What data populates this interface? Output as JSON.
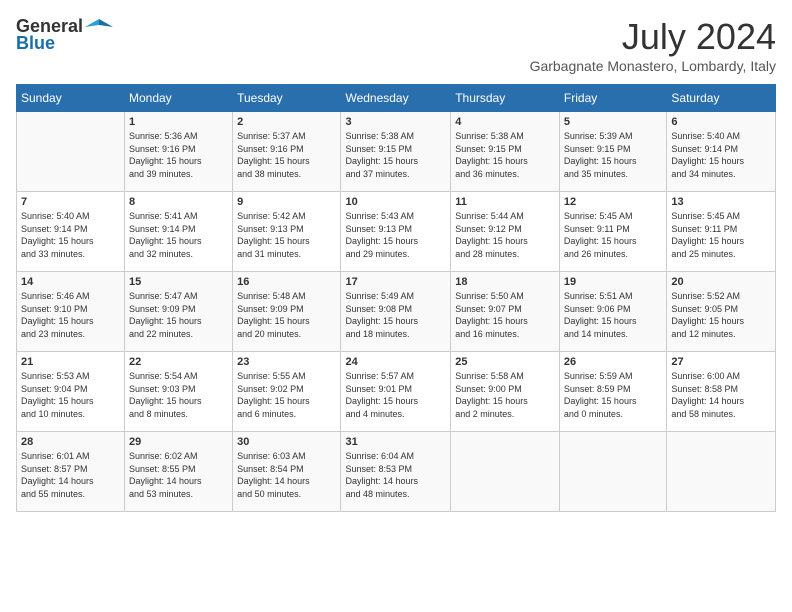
{
  "header": {
    "logo_general": "General",
    "logo_blue": "Blue",
    "month_title": "July 2024",
    "location": "Garbagnate Monastero, Lombardy, Italy"
  },
  "calendar": {
    "days_of_week": [
      "Sunday",
      "Monday",
      "Tuesday",
      "Wednesday",
      "Thursday",
      "Friday",
      "Saturday"
    ],
    "weeks": [
      [
        {
          "day": "",
          "info": ""
        },
        {
          "day": "1",
          "info": "Sunrise: 5:36 AM\nSunset: 9:16 PM\nDaylight: 15 hours\nand 39 minutes."
        },
        {
          "day": "2",
          "info": "Sunrise: 5:37 AM\nSunset: 9:16 PM\nDaylight: 15 hours\nand 38 minutes."
        },
        {
          "day": "3",
          "info": "Sunrise: 5:38 AM\nSunset: 9:15 PM\nDaylight: 15 hours\nand 37 minutes."
        },
        {
          "day": "4",
          "info": "Sunrise: 5:38 AM\nSunset: 9:15 PM\nDaylight: 15 hours\nand 36 minutes."
        },
        {
          "day": "5",
          "info": "Sunrise: 5:39 AM\nSunset: 9:15 PM\nDaylight: 15 hours\nand 35 minutes."
        },
        {
          "day": "6",
          "info": "Sunrise: 5:40 AM\nSunset: 9:14 PM\nDaylight: 15 hours\nand 34 minutes."
        }
      ],
      [
        {
          "day": "7",
          "info": "Sunrise: 5:40 AM\nSunset: 9:14 PM\nDaylight: 15 hours\nand 33 minutes."
        },
        {
          "day": "8",
          "info": "Sunrise: 5:41 AM\nSunset: 9:14 PM\nDaylight: 15 hours\nand 32 minutes."
        },
        {
          "day": "9",
          "info": "Sunrise: 5:42 AM\nSunset: 9:13 PM\nDaylight: 15 hours\nand 31 minutes."
        },
        {
          "day": "10",
          "info": "Sunrise: 5:43 AM\nSunset: 9:13 PM\nDaylight: 15 hours\nand 29 minutes."
        },
        {
          "day": "11",
          "info": "Sunrise: 5:44 AM\nSunset: 9:12 PM\nDaylight: 15 hours\nand 28 minutes."
        },
        {
          "day": "12",
          "info": "Sunrise: 5:45 AM\nSunset: 9:11 PM\nDaylight: 15 hours\nand 26 minutes."
        },
        {
          "day": "13",
          "info": "Sunrise: 5:45 AM\nSunset: 9:11 PM\nDaylight: 15 hours\nand 25 minutes."
        }
      ],
      [
        {
          "day": "14",
          "info": "Sunrise: 5:46 AM\nSunset: 9:10 PM\nDaylight: 15 hours\nand 23 minutes."
        },
        {
          "day": "15",
          "info": "Sunrise: 5:47 AM\nSunset: 9:09 PM\nDaylight: 15 hours\nand 22 minutes."
        },
        {
          "day": "16",
          "info": "Sunrise: 5:48 AM\nSunset: 9:09 PM\nDaylight: 15 hours\nand 20 minutes."
        },
        {
          "day": "17",
          "info": "Sunrise: 5:49 AM\nSunset: 9:08 PM\nDaylight: 15 hours\nand 18 minutes."
        },
        {
          "day": "18",
          "info": "Sunrise: 5:50 AM\nSunset: 9:07 PM\nDaylight: 15 hours\nand 16 minutes."
        },
        {
          "day": "19",
          "info": "Sunrise: 5:51 AM\nSunset: 9:06 PM\nDaylight: 15 hours\nand 14 minutes."
        },
        {
          "day": "20",
          "info": "Sunrise: 5:52 AM\nSunset: 9:05 PM\nDaylight: 15 hours\nand 12 minutes."
        }
      ],
      [
        {
          "day": "21",
          "info": "Sunrise: 5:53 AM\nSunset: 9:04 PM\nDaylight: 15 hours\nand 10 minutes."
        },
        {
          "day": "22",
          "info": "Sunrise: 5:54 AM\nSunset: 9:03 PM\nDaylight: 15 hours\nand 8 minutes."
        },
        {
          "day": "23",
          "info": "Sunrise: 5:55 AM\nSunset: 9:02 PM\nDaylight: 15 hours\nand 6 minutes."
        },
        {
          "day": "24",
          "info": "Sunrise: 5:57 AM\nSunset: 9:01 PM\nDaylight: 15 hours\nand 4 minutes."
        },
        {
          "day": "25",
          "info": "Sunrise: 5:58 AM\nSunset: 9:00 PM\nDaylight: 15 hours\nand 2 minutes."
        },
        {
          "day": "26",
          "info": "Sunrise: 5:59 AM\nSunset: 8:59 PM\nDaylight: 15 hours\nand 0 minutes."
        },
        {
          "day": "27",
          "info": "Sunrise: 6:00 AM\nSunset: 8:58 PM\nDaylight: 14 hours\nand 58 minutes."
        }
      ],
      [
        {
          "day": "28",
          "info": "Sunrise: 6:01 AM\nSunset: 8:57 PM\nDaylight: 14 hours\nand 55 minutes."
        },
        {
          "day": "29",
          "info": "Sunrise: 6:02 AM\nSunset: 8:55 PM\nDaylight: 14 hours\nand 53 minutes."
        },
        {
          "day": "30",
          "info": "Sunrise: 6:03 AM\nSunset: 8:54 PM\nDaylight: 14 hours\nand 50 minutes."
        },
        {
          "day": "31",
          "info": "Sunrise: 6:04 AM\nSunset: 8:53 PM\nDaylight: 14 hours\nand 48 minutes."
        },
        {
          "day": "",
          "info": ""
        },
        {
          "day": "",
          "info": ""
        },
        {
          "day": "",
          "info": ""
        }
      ]
    ]
  }
}
